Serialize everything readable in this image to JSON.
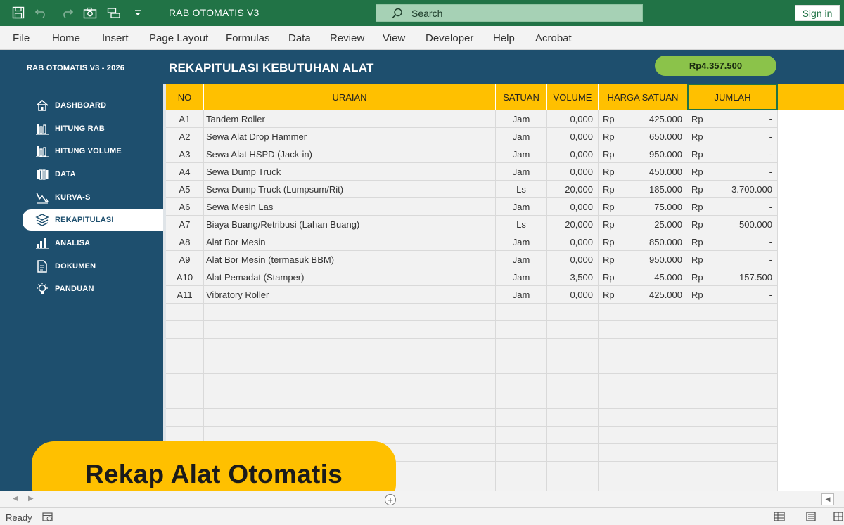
{
  "window": {
    "title": "RAB OTOMATIS V3",
    "search_placeholder": "Search",
    "signin_label": "Sign in"
  },
  "ribbon": [
    "File",
    "Home",
    "Insert",
    "Page Layout",
    "Formulas",
    "Data",
    "Review",
    "View",
    "Developer",
    "Help",
    "Acrobat"
  ],
  "header": {
    "brand": "RAB OTOMATIS V3 - 2026",
    "title": "REKAPITULASI KEBUTUHAN ALAT",
    "total": "Rp4.357.500"
  },
  "sidebar": {
    "items": [
      {
        "label": "DASHBOARD",
        "icon": "home-icon",
        "active": false
      },
      {
        "label": "HITUNG RAB",
        "icon": "bar-chart-icon",
        "active": false
      },
      {
        "label": "HITUNG VOLUME",
        "icon": "bar-chart-icon",
        "active": false
      },
      {
        "label": "DATA",
        "icon": "data-icon",
        "active": false
      },
      {
        "label": "KURVA-S",
        "icon": "trend-icon",
        "active": false
      },
      {
        "label": "REKAPITULASI",
        "icon": "layers-icon",
        "active": true
      },
      {
        "label": "ANALISA",
        "icon": "analytics-icon",
        "active": false
      },
      {
        "label": "DOKUMEN",
        "icon": "document-icon",
        "active": false
      },
      {
        "label": "PANDUAN",
        "icon": "lightbulb-icon",
        "active": false
      }
    ]
  },
  "table": {
    "columns": {
      "no": "NO",
      "uraian": "URAIAN",
      "satuan": "SATUAN",
      "volume": "VOLUME",
      "harga": "HARGA SATUAN",
      "jumlah": "JUMLAH"
    },
    "currency": "Rp",
    "rows": [
      {
        "no": "A1",
        "uraian": "Tandem Roller",
        "satuan": "Jam",
        "volume": "0,000",
        "harga": "425.000",
        "jumlah": "-"
      },
      {
        "no": "A2",
        "uraian": "Sewa Alat Drop Hammer",
        "satuan": "Jam",
        "volume": "0,000",
        "harga": "650.000",
        "jumlah": "-"
      },
      {
        "no": "A3",
        "uraian": "Sewa Alat HSPD (Jack-in)",
        "satuan": "Jam",
        "volume": "0,000",
        "harga": "950.000",
        "jumlah": "-"
      },
      {
        "no": "A4",
        "uraian": "Sewa Dump Truck",
        "satuan": "Jam",
        "volume": "0,000",
        "harga": "450.000",
        "jumlah": "-"
      },
      {
        "no": "A5",
        "uraian": "Sewa Dump Truck (Lumpsum/Rit)",
        "satuan": "Ls",
        "volume": "20,000",
        "harga": "185.000",
        "jumlah": "3.700.000"
      },
      {
        "no": "A6",
        "uraian": "Sewa Mesin Las",
        "satuan": "Jam",
        "volume": "0,000",
        "harga": "75.000",
        "jumlah": "-"
      },
      {
        "no": "A7",
        "uraian": "Biaya Buang/Retribusi (Lahan Buang)",
        "satuan": "Ls",
        "volume": "20,000",
        "harga": "25.000",
        "jumlah": "500.000"
      },
      {
        "no": "A8",
        "uraian": "Alat Bor Mesin",
        "satuan": "Jam",
        "volume": "0,000",
        "harga": "850.000",
        "jumlah": "-"
      },
      {
        "no": "A9",
        "uraian": "Alat Bor Mesin (termasuk BBM)",
        "satuan": "Jam",
        "volume": "0,000",
        "harga": "950.000",
        "jumlah": "-"
      },
      {
        "no": "A10",
        "uraian": "Alat Pemadat (Stamper)",
        "satuan": "Jam",
        "volume": "3,500",
        "harga": "45.000",
        "jumlah": "157.500"
      },
      {
        "no": "A11",
        "uraian": "Vibratory Roller",
        "satuan": "Jam",
        "volume": "0,000",
        "harga": "425.000",
        "jumlah": "-"
      }
    ]
  },
  "banner": "Rekap Alat Otomatis",
  "status": "Ready"
}
